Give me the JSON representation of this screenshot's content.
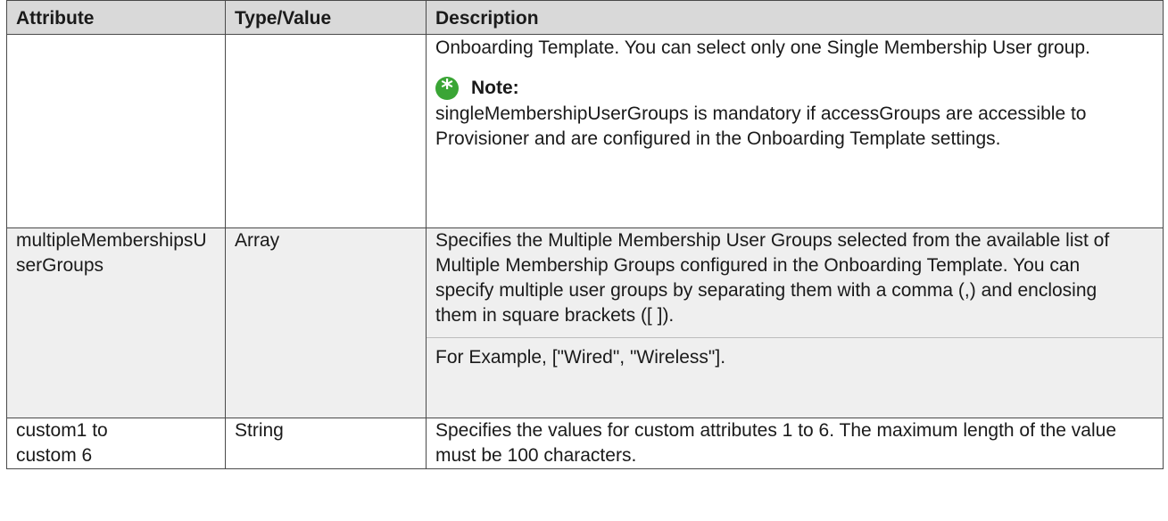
{
  "table": {
    "headers": [
      "Attribute",
      "Type/Value",
      "Description"
    ],
    "rows": [
      {
        "attribute": "",
        "type": "",
        "description_p1": "Onboarding Template. You can select only one Single Membership User group.",
        "note_label": "Note:",
        "note_text": "singleMembershipUserGroups is mandatory if accessGroups are accessible to Provisioner and are configured in the Onboarding Template settings."
      },
      {
        "attribute": "multipleMembershipsUserGroups",
        "type": "Array",
        "description_p1": "Specifies the Multiple Membership User Groups selected from the available list of Multiple Membership Groups configured in the Onboarding Template. You can specify multiple user groups by separating them with a comma (,) and enclosing them in square brackets ([ ]).",
        "description_p2": "For Example, [\"Wired\", \"Wireless\"]."
      },
      {
        "attribute": "custom1 to custom 6",
        "type": "String",
        "description_p1": "Specifies the values for custom attributes 1 to 6. The maximum length of the value must be 100 characters."
      }
    ]
  },
  "icons": {
    "note": "asterisk-icon"
  },
  "colors": {
    "header_bg": "#d9d9d9",
    "shaded_row_bg": "#efefef",
    "note_icon": "#3aa535"
  }
}
